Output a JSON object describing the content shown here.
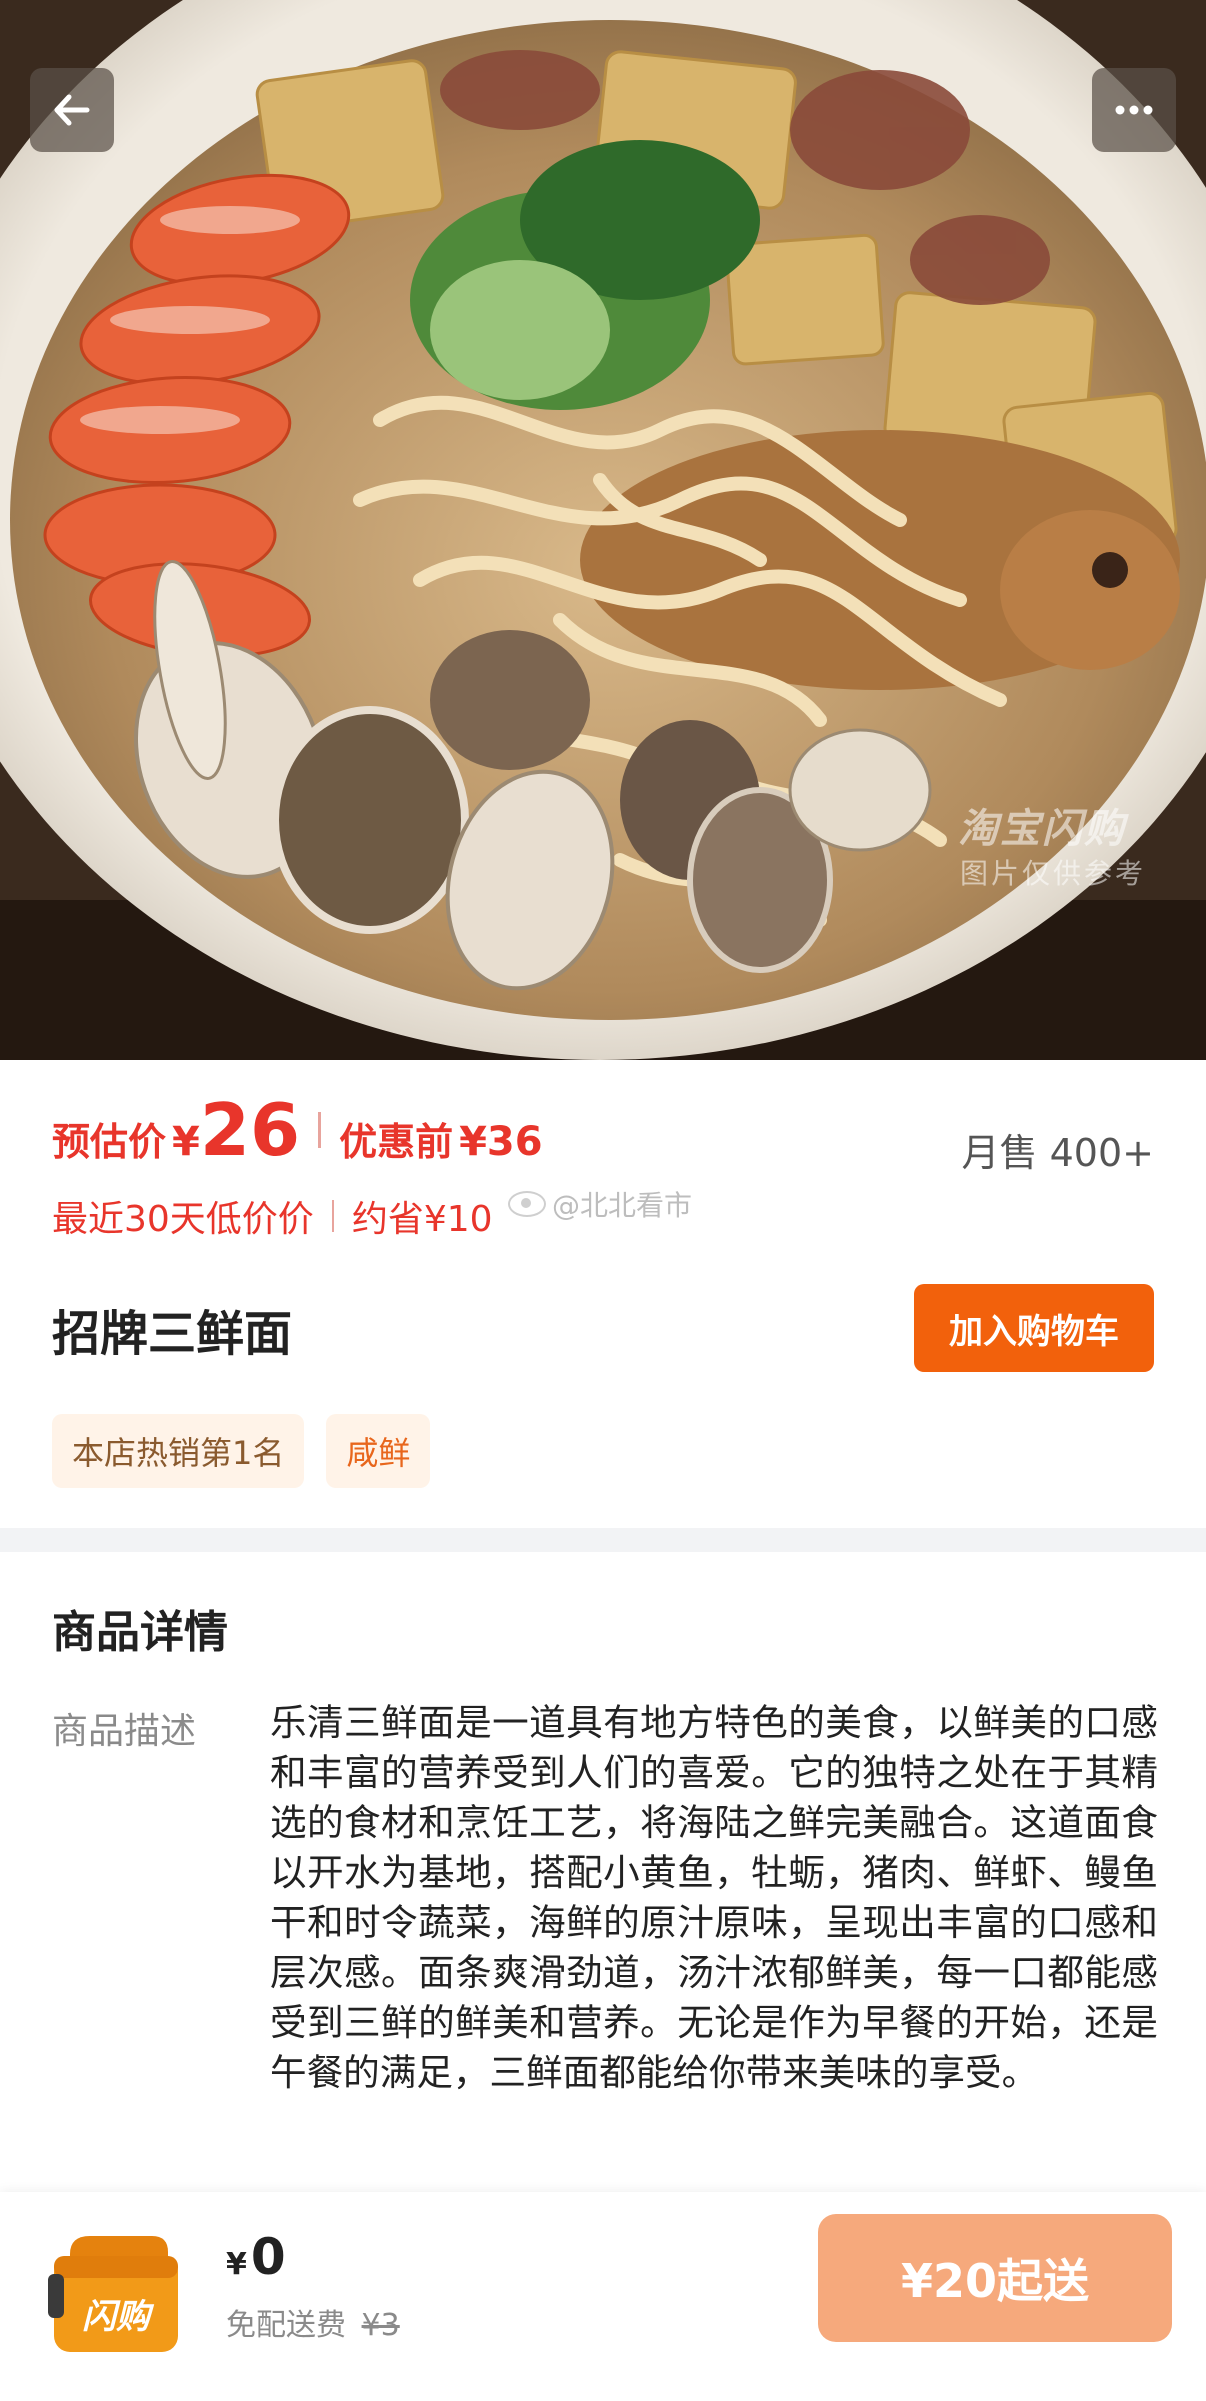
{
  "hero": {
    "watermark_brand": "淘宝闪购",
    "watermark_note": "图片仅供参考",
    "icons": {
      "back": "arrow-left-icon",
      "more": "more-dots-icon"
    }
  },
  "price": {
    "estimated_label": "预估价",
    "currency": "¥",
    "estimated_value": "26",
    "original_label": "优惠前",
    "original_value": "¥36",
    "monthly_sales": "月售 400+",
    "low_price_text": "最近30天低价价",
    "savings_text": "约省¥10",
    "colors": {
      "accent": "#e8352b",
      "button": "#f2610c"
    }
  },
  "watermark_social": "@北北看市",
  "product": {
    "name": "招牌三鲜面",
    "add_cart_label": "加入购物车",
    "tags": [
      "本店热销第1名",
      "咸鲜"
    ]
  },
  "details": {
    "title": "商品详情",
    "desc_label": "商品描述",
    "desc_text": "乐清三鲜面是一道具有地方特色的美食，以鲜美的口感和丰富的营养受到人们的喜爱。它的独特之处在于其精选的食材和烹饪工艺，将海陆之鲜完美融合。这道面食以开水为基地，搭配小黄鱼，牡蛎，猪肉、鲜虾、鳗鱼干和时令蔬菜，海鲜的原汁原味，呈现出丰富的口感和层次感。面条爽滑劲道，汤汁浓郁鲜美，每一口都能感受到三鲜的鲜美和营养。无论是作为早餐的开始，还是午餐的满足，三鲜面都能给你带来美味的享受。"
  },
  "bottom": {
    "bag_label": "闪购",
    "currency": "¥",
    "delivery_amount": "0",
    "free_delivery_label": "免配送费",
    "original_fee": "¥3",
    "min_order_label": "¥20起送",
    "colors": {
      "bag": "#f29a18",
      "button": "#f6a97c"
    }
  }
}
